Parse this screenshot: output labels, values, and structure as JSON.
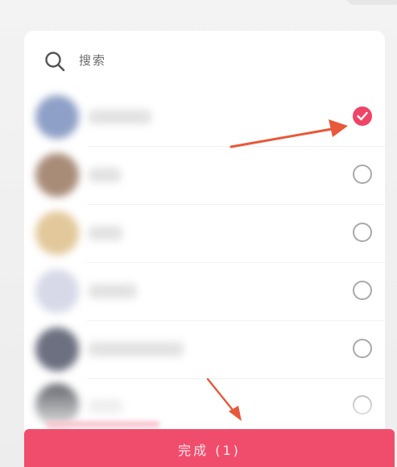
{
  "search": {
    "placeholder": "搜索"
  },
  "contacts": [
    {
      "selected": true,
      "avatar_color": "#8ea0c7"
    },
    {
      "selected": false,
      "avatar_color": "#a88c78"
    },
    {
      "selected": false,
      "avatar_color": "#e2c89a"
    },
    {
      "selected": false,
      "avatar_color": "#d7d9e8"
    },
    {
      "selected": false,
      "avatar_color": "#6c7080"
    },
    {
      "selected": false,
      "avatar_color": "#55585e"
    }
  ],
  "footer": {
    "done_label": "完成 (1)"
  },
  "colors": {
    "accent": "#f04466",
    "button": "#f04d6c",
    "annotation_arrow": "#e8583a"
  },
  "icons": {
    "search": "search-icon",
    "check": "check-icon",
    "radio_empty": "radio-empty-icon"
  }
}
